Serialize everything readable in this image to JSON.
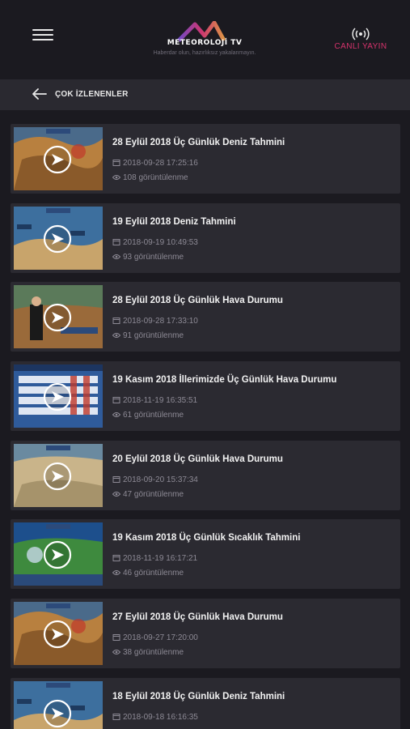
{
  "header": {
    "logo_text": "METEOROLOJİ TV",
    "tagline": "Haberdar olun, hazırlıksız yakalanmayın.",
    "live_label": "CANLI YAYIN",
    "colors": {
      "accent": "#d6336c",
      "background": "#1b1a20",
      "card": "#2b2a31"
    }
  },
  "subbar": {
    "title": "ÇOK İZLENENLER"
  },
  "items": [
    {
      "title": "28 Eylül 2018 Üç Günlük Deniz Tahmini",
      "date": "2018-09-28 17:25:16",
      "views": "108 görüntülenme",
      "thumb_style": "map-orange"
    },
    {
      "title": "19 Eylül 2018 Deniz Tahmini",
      "date": "2018-09-19 10:49:53",
      "views": "93 görüntülenme",
      "thumb_style": "map-sea"
    },
    {
      "title": "28 Eylül 2018 Üç Günlük Hava Durumu",
      "date": "2018-09-28 17:33:10",
      "views": "91 görüntülenme",
      "thumb_style": "map-presenter"
    },
    {
      "title": "19 Kasım 2018 İllerimizde Üç Günlük Hava Durumu",
      "date": "2018-11-19 16:35:51",
      "views": "61 görüntülenme",
      "thumb_style": "table-blue"
    },
    {
      "title": "20 Eylül 2018 Üç Günlük Hava Durumu",
      "date": "2018-09-20 15:37:34",
      "views": "47 görüntülenme",
      "thumb_style": "map-beige"
    },
    {
      "title": "19 Kasım 2018 Üç Günlük Sıcaklık Tahmini",
      "date": "2018-11-19 16:17:21",
      "views": "46 görüntülenme",
      "thumb_style": "map-green"
    },
    {
      "title": "27 Eylül 2018 Üç Günlük Hava Durumu",
      "date": "2018-09-27 17:20:00",
      "views": "38 görüntülenme",
      "thumb_style": "map-orange"
    },
    {
      "title": "18 Eylül 2018 Üç Günlük Deniz Tahmini",
      "date": "2018-09-18 16:16:35",
      "views": "",
      "thumb_style": "map-sea"
    }
  ]
}
